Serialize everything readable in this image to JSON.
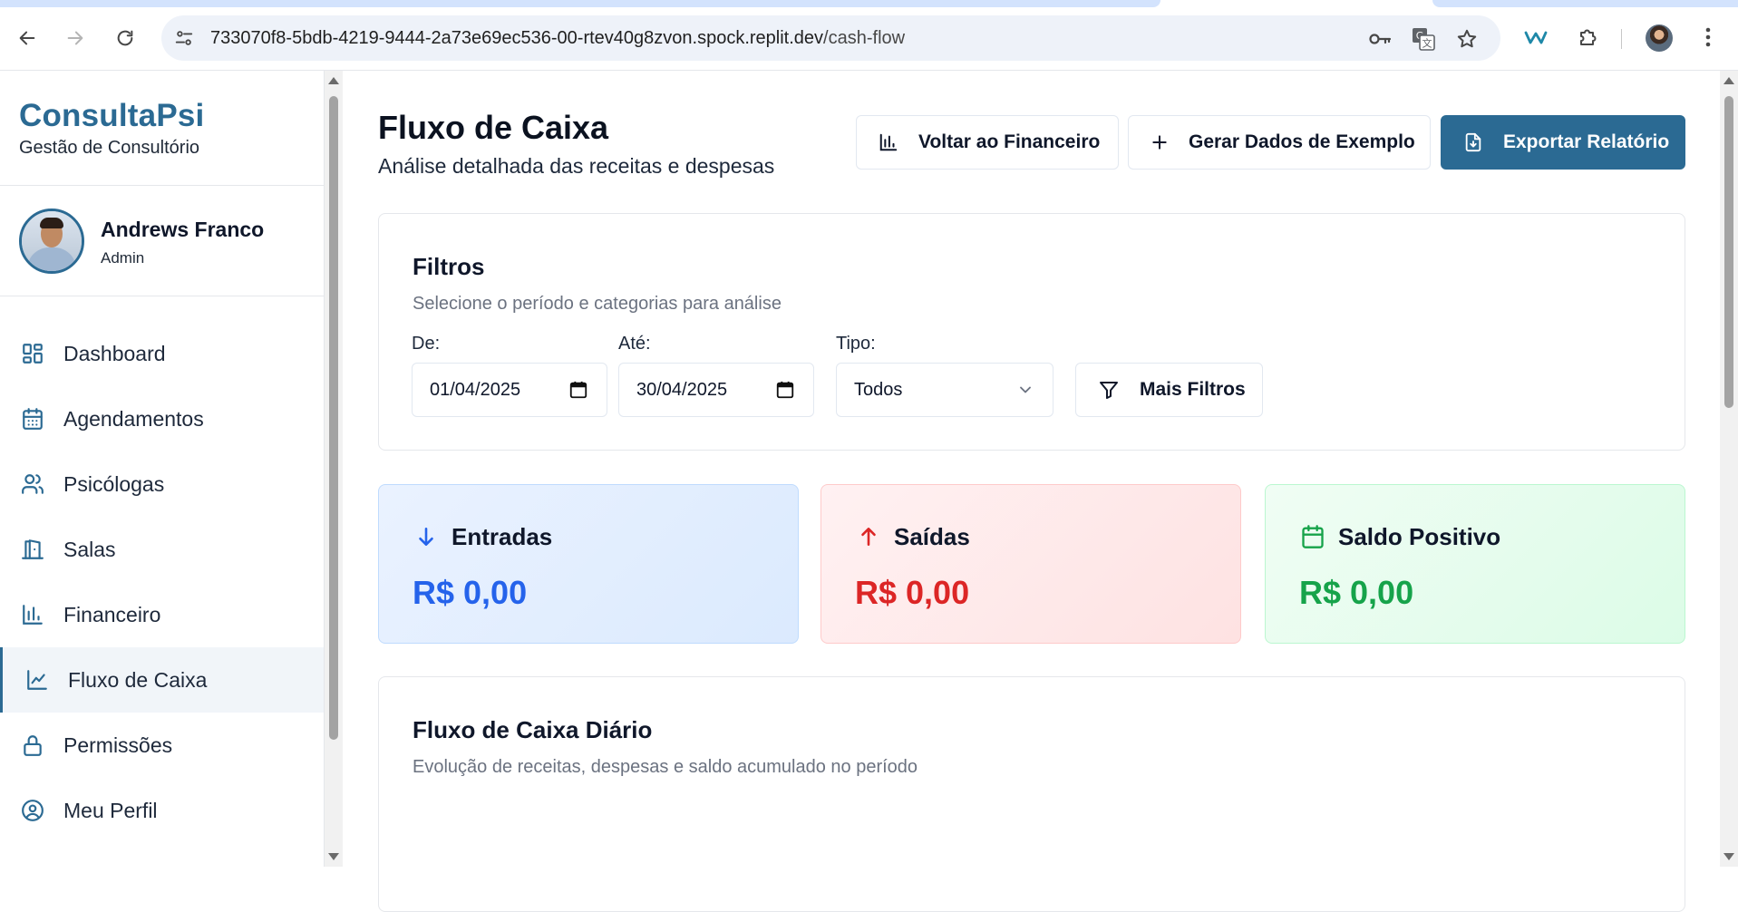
{
  "browser": {
    "url_host": "733070f8-5bdb-4219-9444-2a73e69ec536-00-rtev40g8zvon.spock.replit.dev",
    "url_path": "/cash-flow",
    "icons": [
      "back-icon",
      "forward-icon",
      "reload-icon",
      "site-settings-icon",
      "password-key-icon",
      "translate-icon",
      "bookmark-star-icon",
      "extension-w-icon",
      "extensions-puzzle-icon",
      "profile-avatar",
      "menu-dots-icon"
    ]
  },
  "sidebar": {
    "brand": "ConsultaPsi",
    "subtitle": "Gestão de Consultório",
    "user": {
      "name": "Andrews Franco",
      "role": "Admin"
    },
    "items": [
      {
        "label": "Dashboard",
        "icon": "dashboard-icon"
      },
      {
        "label": "Agendamentos",
        "icon": "calendar-icon"
      },
      {
        "label": "Psicólogas",
        "icon": "users-icon"
      },
      {
        "label": "Salas",
        "icon": "door-icon"
      },
      {
        "label": "Financeiro",
        "icon": "bar-chart-icon"
      },
      {
        "label": "Fluxo de Caixa",
        "icon": "line-chart-icon",
        "active": true
      },
      {
        "label": "Permissões",
        "icon": "lock-icon"
      },
      {
        "label": "Meu Perfil",
        "icon": "user-circle-icon"
      }
    ]
  },
  "header": {
    "title": "Fluxo de Caixa",
    "subtitle": "Análise detalhada das receitas e despesas",
    "buttons": {
      "back_finance": "Voltar ao Financeiro",
      "generate_sample": "Gerar Dados de Exemplo",
      "export_report": "Exportar Relatório"
    }
  },
  "filters": {
    "title": "Filtros",
    "description": "Selecione o período e categorias para análise",
    "from_label": "De:",
    "from_value": "01/04/2025",
    "to_label": "Até:",
    "to_value": "30/04/2025",
    "type_label": "Tipo:",
    "type_value": "Todos",
    "more_filters": "Mais Filtros"
  },
  "stats": [
    {
      "title": "Entradas",
      "value": "R$ 0,00",
      "color": "#2563eb",
      "icon": "arrow-down-icon"
    },
    {
      "title": "Saídas",
      "value": "R$ 0,00",
      "color": "#dc2626",
      "icon": "arrow-up-icon"
    },
    {
      "title": "Saldo Positivo",
      "value": "R$ 0,00",
      "color": "#16a34a",
      "icon": "calendar-icon"
    }
  ],
  "daily_flow": {
    "title": "Fluxo de Caixa Diário",
    "description": "Evolução de receitas, despesas e saldo acumulado no período"
  },
  "colors": {
    "brand": "#2b6a93",
    "income": "#2563eb",
    "expense": "#dc2626",
    "balance": "#16a34a"
  }
}
